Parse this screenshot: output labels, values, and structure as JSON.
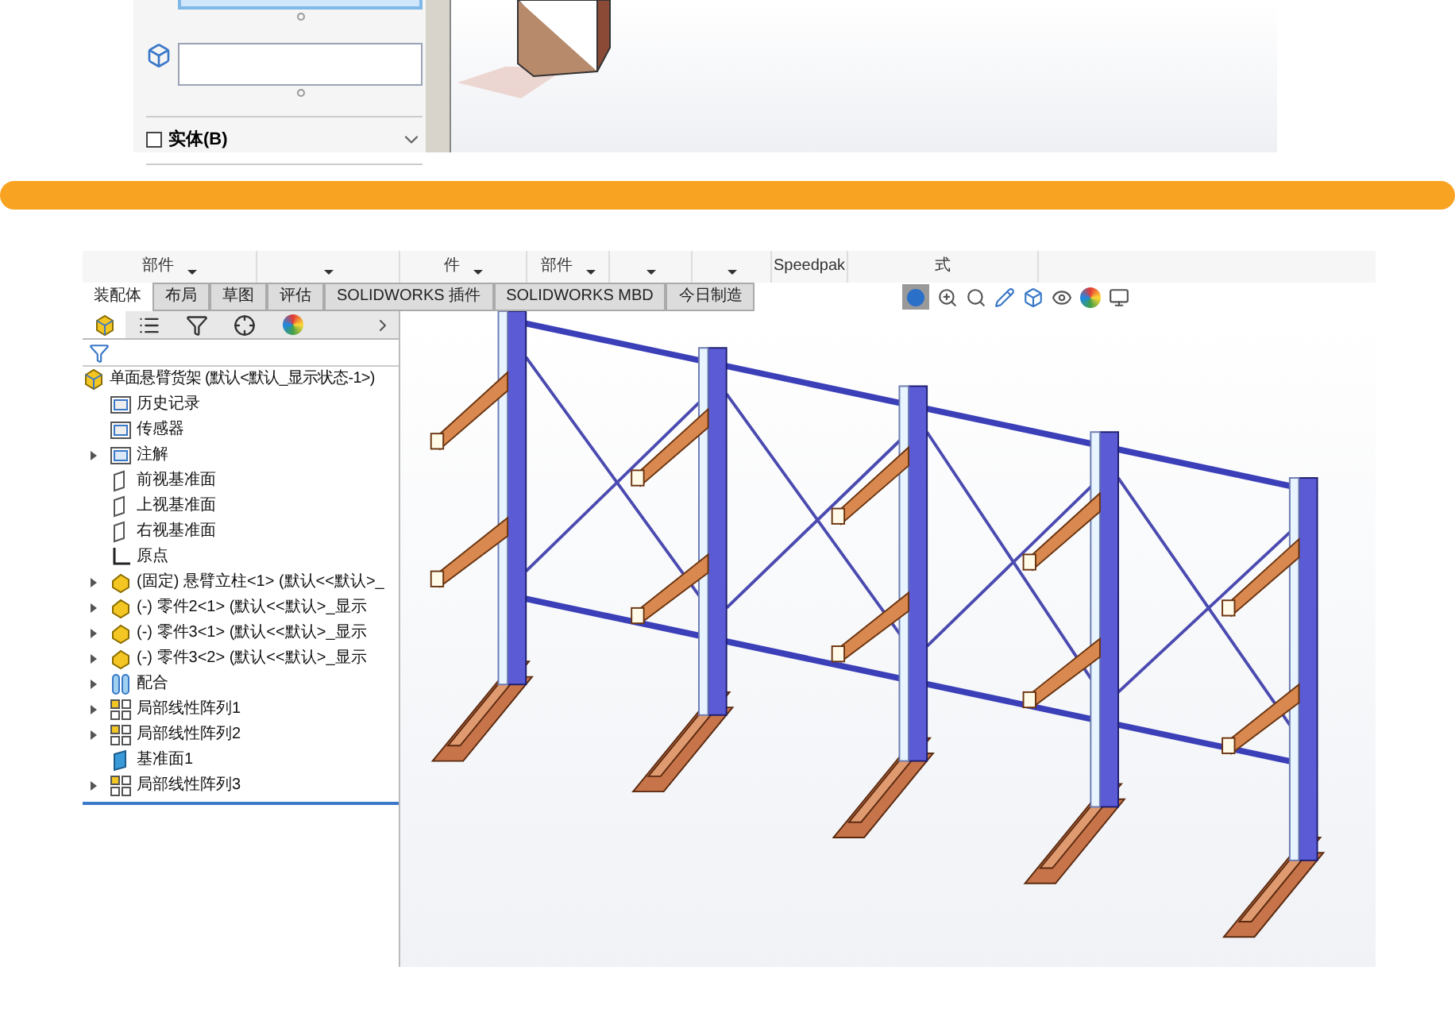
{
  "property_panel": {
    "fields": [
      {
        "selected": true
      },
      {
        "selected": false
      }
    ],
    "checkbox": {
      "label": "实体(B)",
      "checked": false
    }
  },
  "cad_window": {
    "ribbon": [
      {
        "text": "部件",
        "dropdown": true
      },
      {
        "dropdown": true
      },
      {
        "text": "件",
        "dropdown": true
      },
      {
        "text": "部件",
        "dropdown": true
      },
      {
        "dropdown": true
      },
      {
        "dropdown": true
      },
      {
        "text": "Speedpak",
        "dropdown": false
      },
      {
        "text": "式",
        "dropdown": false
      }
    ],
    "tabs": [
      {
        "label": "装配体",
        "selected": true
      },
      {
        "label": "布局",
        "selected": false
      },
      {
        "label": "草图",
        "selected": false
      },
      {
        "label": "评估",
        "selected": false
      },
      {
        "label": "SOLIDWORKS 插件",
        "selected": false
      },
      {
        "label": "SOLIDWORKS MBD",
        "selected": false
      },
      {
        "label": "今日制造",
        "selected": false
      }
    ],
    "tree": [
      {
        "label": "单面悬臂货架 (默认<默认_显示状态-1>)",
        "kind": "assembly",
        "expandable": false,
        "top": true
      },
      {
        "label": "历史记录",
        "kind": "history",
        "expandable": false,
        "top": false
      },
      {
        "label": "传感器",
        "kind": "sensor",
        "expandable": false,
        "top": false
      },
      {
        "label": "注解",
        "kind": "annotation",
        "expandable": true,
        "top": false
      },
      {
        "label": "前视基准面",
        "kind": "plane",
        "expandable": false,
        "top": false
      },
      {
        "label": "上视基准面",
        "kind": "plane",
        "expandable": false,
        "top": false
      },
      {
        "label": "右视基准面",
        "kind": "plane",
        "expandable": false,
        "top": false
      },
      {
        "label": "原点",
        "kind": "origin",
        "expandable": false,
        "top": false
      },
      {
        "label": "(固定) 悬臂立柱<1> (默认<<默认>_",
        "kind": "part",
        "expandable": true,
        "top": false
      },
      {
        "label": "(-) 零件2<1> (默认<<默认>_显示",
        "kind": "part",
        "expandable": true,
        "top": false
      },
      {
        "label": "(-) 零件3<1> (默认<<默认>_显示",
        "kind": "part",
        "expandable": true,
        "top": false
      },
      {
        "label": "(-) 零件3<2> (默认<<默认>_显示",
        "kind": "part",
        "expandable": true,
        "top": false
      },
      {
        "label": "配合",
        "kind": "mate",
        "expandable": true,
        "top": false
      },
      {
        "label": "局部线性阵列1",
        "kind": "pattern",
        "expandable": true,
        "top": false
      },
      {
        "label": "局部线性阵列2",
        "kind": "pattern",
        "expandable": true,
        "top": false
      },
      {
        "label": "基准面1",
        "kind": "refplane",
        "expandable": false,
        "top": false
      },
      {
        "label": "局部线性阵列3",
        "kind": "pattern",
        "expandable": true,
        "top": false
      }
    ]
  }
}
